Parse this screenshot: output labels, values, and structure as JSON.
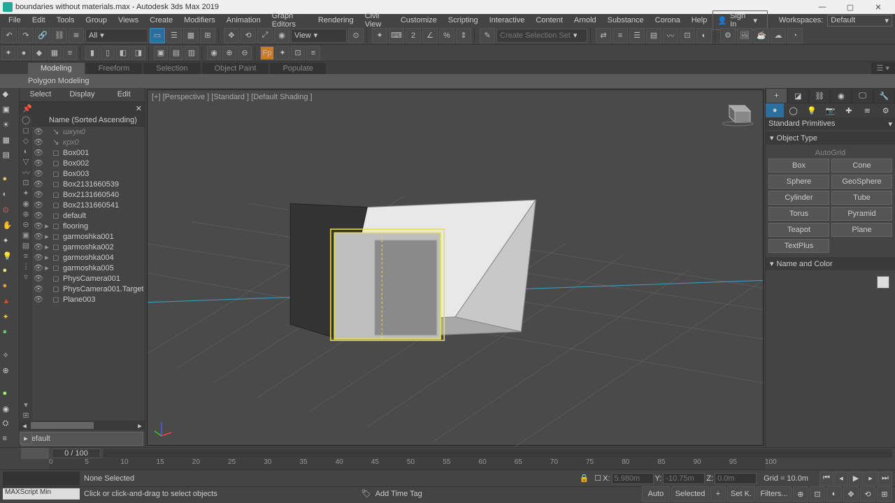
{
  "title": "boundaries without materials.max - Autodesk 3ds Max 2019",
  "menu": [
    "File",
    "Edit",
    "Tools",
    "Group",
    "Views",
    "Create",
    "Modifiers",
    "Animation",
    "Graph Editors",
    "Rendering",
    "Civil View",
    "Customize",
    "Scripting",
    "Interactive",
    "Content",
    "Arnold",
    "Substance",
    "Corona",
    "Help"
  ],
  "signin": "Sign In",
  "workspaces_label": "Workspaces:",
  "workspace_value": "Default",
  "selection_filter": "All",
  "view_label": "View",
  "selectionset_placeholder": "Create Selection Set",
  "ribbon_tabs": [
    "Modeling",
    "Freeform",
    "Selection",
    "Object Paint",
    "Populate"
  ],
  "ribbon_group": "Polygon Modeling",
  "explorer": {
    "tabs": [
      "Select",
      "Display",
      "Edit"
    ],
    "close": "✕",
    "header": "Name (Sorted Ascending)",
    "items": [
      {
        "name": "шкун0",
        "dim": true,
        "arrow": false
      },
      {
        "name": "крх0",
        "dim": true,
        "arrow": false
      },
      {
        "name": "Box001",
        "dim": false,
        "arrow": false
      },
      {
        "name": "Box002",
        "dim": false,
        "arrow": false
      },
      {
        "name": "Box003",
        "dim": false,
        "arrow": false
      },
      {
        "name": "Box2131660539",
        "dim": false,
        "arrow": false
      },
      {
        "name": "Box2131660540",
        "dim": false,
        "arrow": false
      },
      {
        "name": "Box2131660541",
        "dim": false,
        "arrow": false
      },
      {
        "name": "default",
        "dim": false,
        "arrow": false
      },
      {
        "name": "flooring",
        "dim": false,
        "arrow": true
      },
      {
        "name": "garmoshka001",
        "dim": false,
        "arrow": true
      },
      {
        "name": "garmoshka002",
        "dim": false,
        "arrow": true
      },
      {
        "name": "garmoshka004",
        "dim": false,
        "arrow": true
      },
      {
        "name": "garmoshka005",
        "dim": false,
        "arrow": true
      },
      {
        "name": "PhysCamera001",
        "dim": false,
        "arrow": false
      },
      {
        "name": "PhysCamera001.Target",
        "dim": false,
        "arrow": false
      },
      {
        "name": "Plane003",
        "dim": false,
        "arrow": false
      }
    ],
    "default_layer": "Default"
  },
  "viewport_label": "[+] [Perspective ] [Standard ] [Default Shading ]",
  "command_panel": {
    "category": "Standard Primitives",
    "rollouts": {
      "object_type": "Object Type",
      "autogrid": "AutoGrid",
      "primitives": [
        [
          "Box",
          "Cone"
        ],
        [
          "Sphere",
          "GeoSphere"
        ],
        [
          "Cylinder",
          "Tube"
        ],
        [
          "Torus",
          "Pyramid"
        ],
        [
          "Teapot",
          "Plane"
        ],
        [
          "TextPlus",
          ""
        ]
      ],
      "name_color": "Name and Color"
    }
  },
  "timeline": {
    "frame_label": "0 / 100",
    "ticks": [
      0,
      5,
      10,
      15,
      20,
      25,
      30,
      35,
      40,
      45,
      50,
      55,
      60,
      65,
      70,
      75,
      80,
      85,
      90,
      95,
      100
    ]
  },
  "status": {
    "selection": "None Selected",
    "prompt": "Click or click-and-drag to select objects",
    "maxscript": "MAXScript Min",
    "x_label": "X:",
    "x": "5.980m",
    "y_label": "Y:",
    "y": "-10.75m",
    "z_label": "Z:",
    "z": "0.0m",
    "grid": "Grid = 10.0m",
    "addtag": "Add Time Tag",
    "auto": "Auto",
    "selected": "Selected",
    "setk": "Set K.",
    "filters": "Filters..."
  }
}
